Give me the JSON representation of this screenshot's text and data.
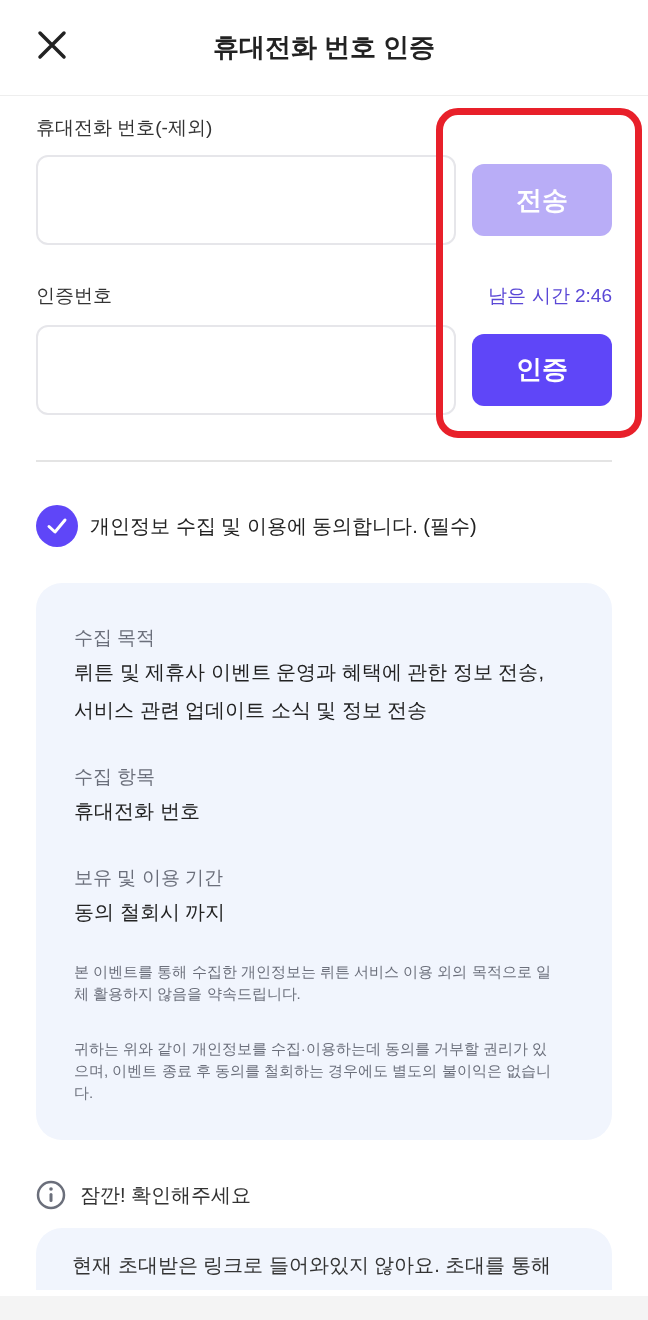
{
  "header": {
    "title": "휴대전화 번호 인증"
  },
  "phone": {
    "label": "휴대전화 번호(-제외)",
    "send_button": {
      "label": "전송",
      "disabled": true
    }
  },
  "code": {
    "label": "인증번호",
    "timer": "남은 시간 2:46",
    "verify_button": {
      "label": "인증",
      "disabled": false
    }
  },
  "consent": {
    "label": "개인정보 수집 및 이용에 동의합니다. (필수)",
    "checked": true
  },
  "details": [
    {
      "heading": "수집 목적",
      "lines": [
        "뤼튼 및 제휴사 이벤트 운영과 혜택에 관한 정보 전송,",
        "서비스 관련 업데이트 소식 및 정보 전송"
      ]
    },
    {
      "heading": "수집 항목",
      "lines": [
        "휴대전화 번호"
      ]
    },
    {
      "heading": "보유 및 이용 기간",
      "lines": [
        "동의 철회시 까지"
      ]
    }
  ],
  "notes": [
    "본 이벤트를 통해 수집한 개인정보는 뤼튼 서비스 이용 외의 목적으로 일체 활용하지 않음을 약속드립니다.",
    "귀하는 위와 같이 개인정보를 수집·이용하는데 동의를 거부할 권리가 있으며, 이벤트 종료 후 동의를 철회하는 경우에도 별도의 불이익은 없습니다."
  ],
  "notice": {
    "title": "잠깐! 확인해주세요",
    "text": "현재 초대받은 링크로 들어와있지 않아요. 초대를 통해"
  }
}
